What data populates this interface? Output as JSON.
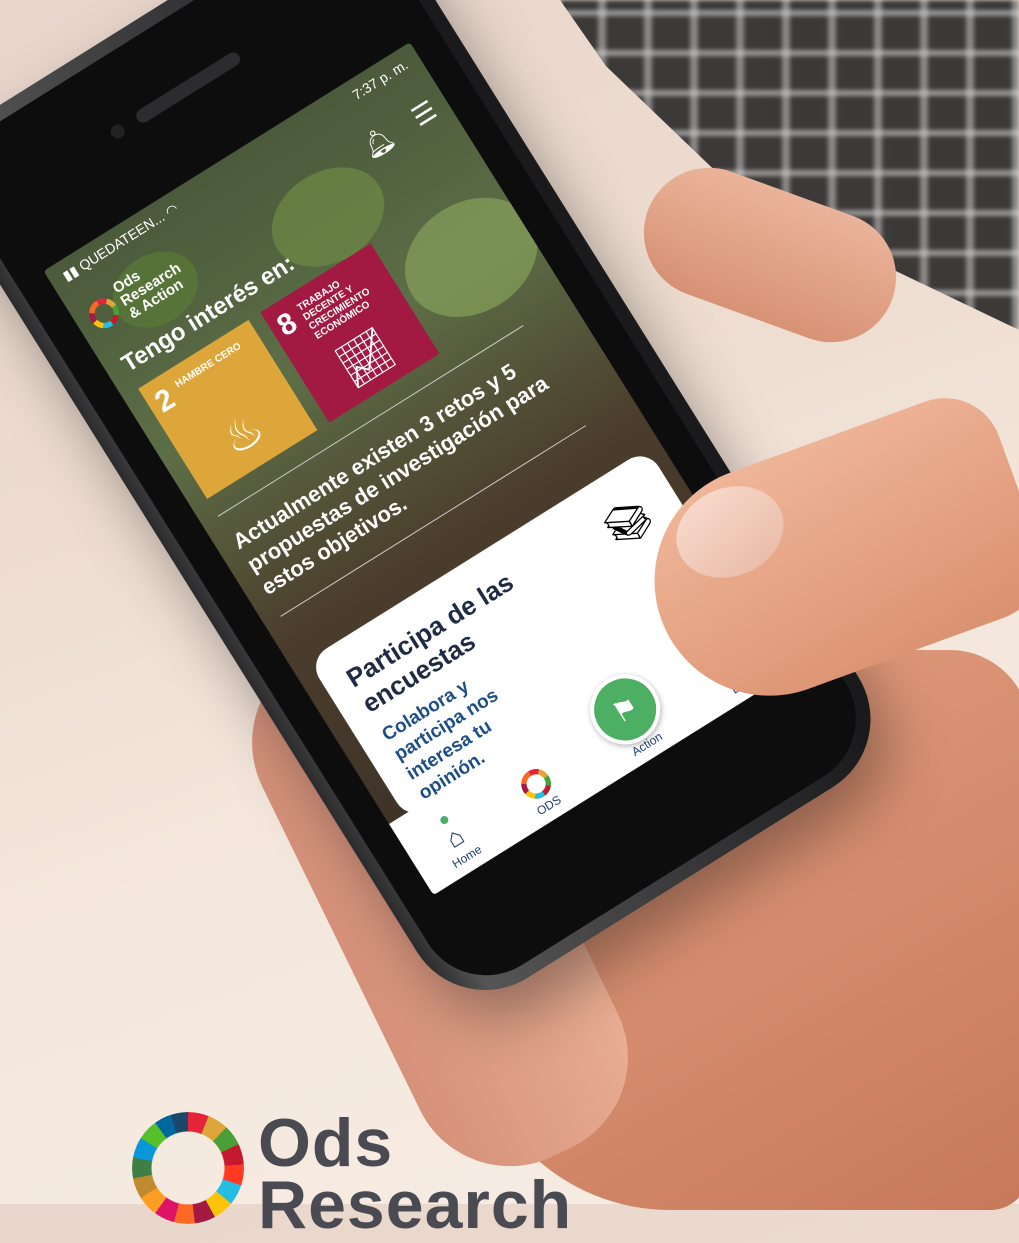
{
  "status": {
    "carrier": "QUEDATEEN...",
    "time": "7:37 p. m."
  },
  "app": {
    "logo_lines": [
      "Ods",
      "Research",
      "& Action"
    ]
  },
  "home": {
    "interest_title": "Tengo interés en:",
    "goals": [
      {
        "number": "2",
        "label": "HAMBRE CERO",
        "color": "#dda63a",
        "icon": "bowl-icon"
      },
      {
        "number": "8",
        "label": "TRABAJO DECENTE Y CRECIMIENTO ECONÓMICO",
        "color": "#a21942",
        "icon": "growth-chart-icon"
      }
    ],
    "info_text": "Actualmente existen 3 retos y 5 propuestas de investigación para estos objetivos."
  },
  "card": {
    "title": "Participa de las encuestas",
    "body": "Colabora y participa nos interesa tu opinión."
  },
  "nav": {
    "items": [
      {
        "label": "Home",
        "icon": "home-icon",
        "active": true
      },
      {
        "label": "ODS",
        "icon": "ods-ring-icon"
      },
      {
        "label": "Action",
        "icon": "flag-mountain-icon"
      },
      {
        "label": "Evento",
        "icon": "calendar-icon"
      }
    ]
  },
  "brand": {
    "lines": [
      "Ods",
      "Research"
    ]
  },
  "colors": {
    "accent_green": "#4caf63",
    "navy": "#1f3b73"
  }
}
